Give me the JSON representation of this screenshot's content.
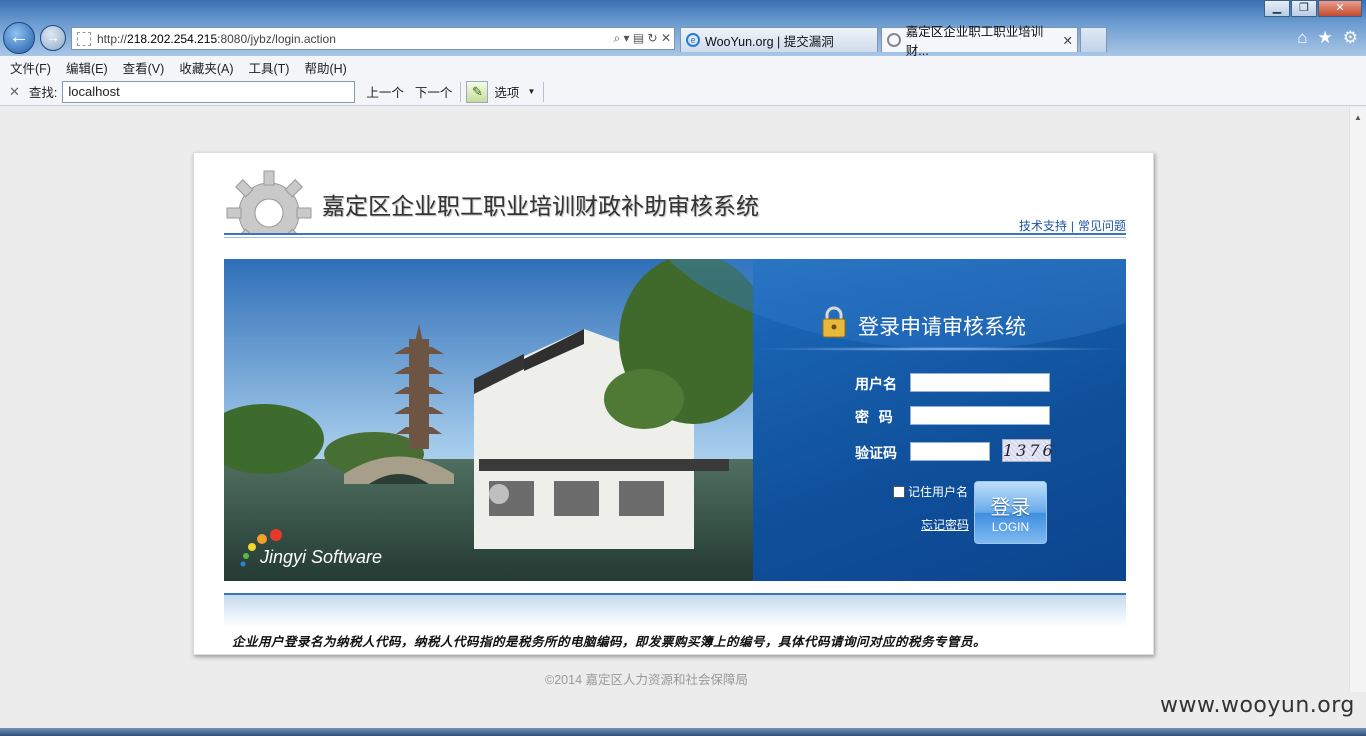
{
  "browser": {
    "window_controls": {
      "minimize": "▁",
      "maximize": "❐",
      "close": "✕"
    },
    "address_url_prefix": "http://",
    "address_host": "218.202.254.215",
    "address_url_rest": ":8080/jybz/login.action",
    "address_controls": "⌕ ▾ ▤ ↻ ✕",
    "tabs": [
      {
        "label": "WooYun.org | 提交漏洞",
        "close": ""
      },
      {
        "label": "嘉定区企业职工职业培训财...",
        "close": "✕"
      }
    ],
    "right_icons": {
      "home": "⌂",
      "favorites": "★",
      "tools": "⚙"
    }
  },
  "menu": [
    "文件(F)",
    "编辑(E)",
    "查看(V)",
    "收藏夹(A)",
    "工具(T)",
    "帮助(H)"
  ],
  "findbar": {
    "close": "✕",
    "label": "查找:",
    "value": "localhost",
    "prev": "上一个",
    "next": "下一个",
    "options": "选项"
  },
  "page": {
    "system_title": "嘉定区企业职工职业培训财政补助审核系统",
    "links": [
      "技术支持",
      "常见问题"
    ],
    "link_separator": "|",
    "photo_brand": "Jingyi Software",
    "login_title": "登录申请审核系统",
    "fields": {
      "username_label": "用户名",
      "password_label": "密  码",
      "captcha_label": "验证码",
      "captcha_text": "1376"
    },
    "remember_label": "记住用户名",
    "forgot_label": "忘记密码",
    "login_button_cn": "登录",
    "login_button_en": "LOGIN",
    "notice": "企业用户登录名为纳税人代码，纳税人代码指的是税务所的电脑编码，即发票购买簿上的编号，具体代码请询问对应的税务专管员。",
    "copyright": "©2014 嘉定区人力资源和社会保障局"
  },
  "watermark": "www.wooyun.org",
  "colors": {
    "accent": "#1d6cbc",
    "link": "#1d55a3"
  }
}
